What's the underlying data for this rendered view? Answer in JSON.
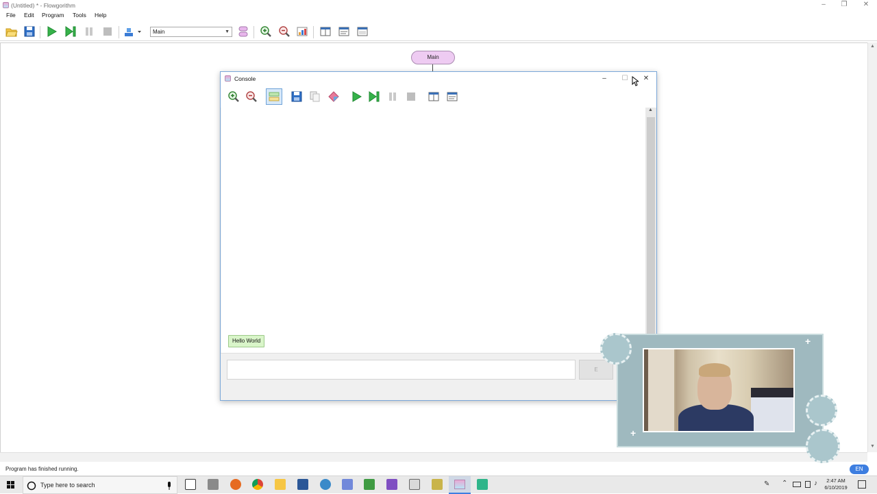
{
  "window": {
    "title": "(Untitled) * - Flowgorithm",
    "controls": {
      "minimize": "–",
      "maximize": "❐",
      "close": "✕"
    }
  },
  "menu": [
    "File",
    "Edit",
    "Program",
    "Tools",
    "Help"
  ],
  "toolbar": {
    "function_select": "Main",
    "icons": [
      "open-icon",
      "save-icon",
      "run-icon",
      "step-icon",
      "pause-icon",
      "stop-icon",
      "layout-icon",
      "functions-icon",
      "zoom-in-icon",
      "zoom-out-icon",
      "chart-icon",
      "variable-watch-icon",
      "console-icon",
      "source-view-icon"
    ]
  },
  "flowchart": {
    "start_label": "Main"
  },
  "console": {
    "title": "Console",
    "controls": {
      "minimize": "–",
      "maximize": "☐",
      "close": "✕"
    },
    "output_message": "Hello World",
    "input_value": "",
    "submit_label": "E"
  },
  "status": {
    "message": "Program has finished running."
  },
  "taskbar": {
    "search_placeholder": "Type here to search",
    "clock_time": "2:47 AM",
    "clock_date": "6/10/2019",
    "language": "EN"
  },
  "colors": {
    "accent": "#3d7ee0",
    "main_shape_fill": "#eecbf2",
    "console_output_fill": "#d9f5c9",
    "webcam_frame": "#9fb9bf"
  }
}
